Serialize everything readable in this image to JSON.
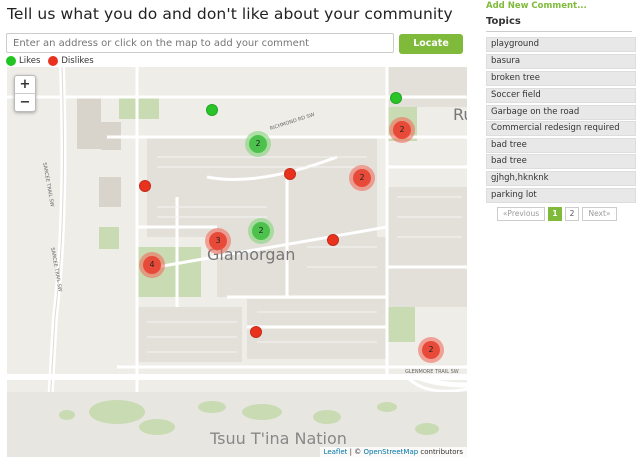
{
  "header": {
    "title": "Tell us what you do and don't like about your community"
  },
  "search": {
    "placeholder": "Enter an address or click on the map to add your comment",
    "locate_label": "Locate"
  },
  "legend": {
    "likes_label": "Likes",
    "dislikes_label": "Dislikes",
    "likes_color": "#22c422",
    "dislikes_color": "#e8321e"
  },
  "map": {
    "zoom_in": "+",
    "zoom_out": "−",
    "place_labels": {
      "glamorgan": "Glamorgan",
      "tsuu_tina": "Tsuu T'ina Nation",
      "rut": "Ru"
    },
    "street_labels": {
      "richmond": "RICHMOND RD SW",
      "sarcee_1": "SARCEE TRAIL SW",
      "sarcee_2": "SARCEE TRAIL SW",
      "glenmore": "GLENMORE TRAIL SW"
    },
    "clusters": [
      {
        "type": "red",
        "count": "2"
      },
      {
        "type": "green",
        "count": "2"
      },
      {
        "type": "red",
        "count": "2"
      },
      {
        "type": "green",
        "count": "2"
      },
      {
        "type": "red",
        "count": "3"
      },
      {
        "type": "red",
        "count": "4"
      },
      {
        "type": "red",
        "count": "2"
      }
    ],
    "attribution": {
      "leaflet": "Leaflet",
      "sep": " | © ",
      "osm": "OpenStreetMap",
      "contrib": " contributors"
    }
  },
  "sidebar": {
    "add_new": "Add New Comment...",
    "topics_heading": "Topics",
    "topics": [
      "playground",
      "basura",
      "broken tree",
      "Soccer field",
      "Garbage on the road",
      "Commercial redesign required",
      "bad tree",
      "bad tree",
      "gjhgh,hknknk",
      "parking lot"
    ],
    "pagination": {
      "previous": "«Previous",
      "pages": [
        "1",
        "2"
      ],
      "next": "Next»"
    }
  }
}
